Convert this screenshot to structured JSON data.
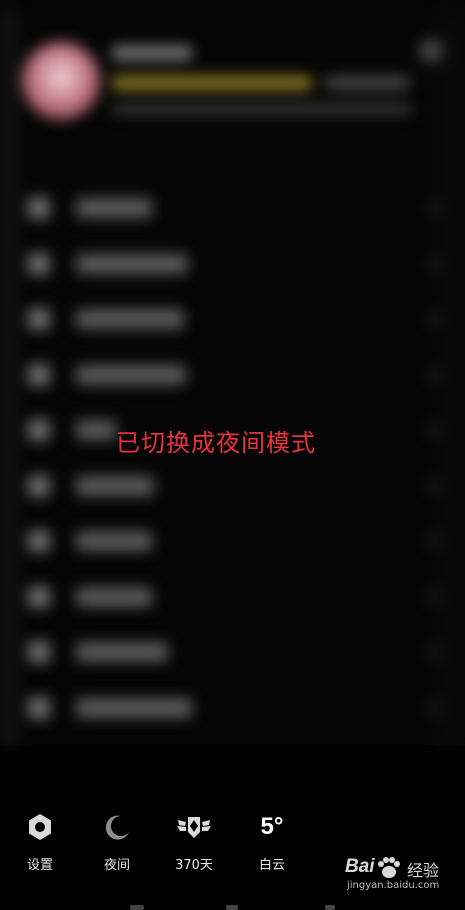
{
  "toast": {
    "text": "已切换成夜间模式"
  },
  "bottom_bar": {
    "tools": [
      {
        "icon": "settings-hexagon-icon",
        "label": "设置"
      },
      {
        "icon": "moon-icon",
        "label": "夜间"
      },
      {
        "icon": "winged-badge-icon",
        "label": "370天"
      },
      {
        "temp": "5°",
        "label": "白云"
      }
    ]
  },
  "watermark": {
    "logo_a": "Bai",
    "logo_b": "经验",
    "url": "jingyan.baidu.com"
  },
  "colors": {
    "background": "#000000",
    "toast_text": "#e8333b",
    "toolbar_text": "#e6e6e6"
  }
}
